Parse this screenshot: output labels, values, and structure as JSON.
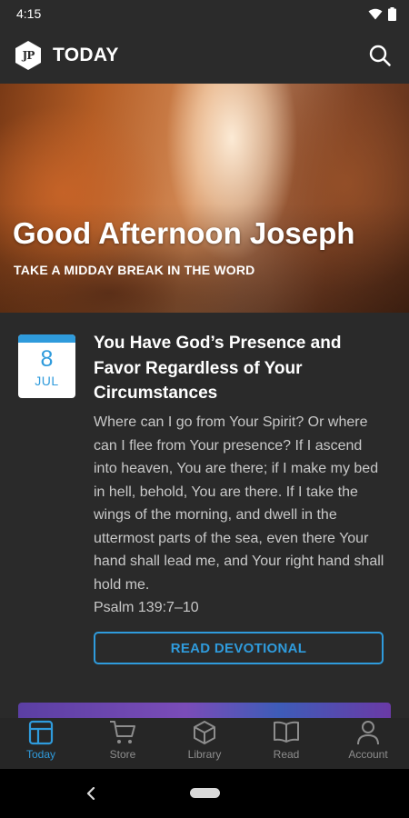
{
  "status_bar": {
    "time": "4:15"
  },
  "app_bar": {
    "logo_text": "JP",
    "title": "TODAY"
  },
  "hero": {
    "greeting": "Good Afternoon Joseph",
    "subtitle": "TAKE A MIDDAY BREAK IN THE WORD"
  },
  "devotional": {
    "date_day": "8",
    "date_month": "JUL",
    "title": "You Have God’s Presence and Favor Regardless of Your Circumstances",
    "body": "Where can I go from Your Spirit? Or where can I flee from Your presence? If I ascend into heaven, You are there; if I make my bed in hell, behold, You are there. If I take the wings of the morning, and dwell in the uttermost parts of the sea, even there Your hand shall lead me, and Your right hand shall hold me.",
    "reference": "Psalm 139:7–10",
    "button_label": "READ DEVOTIONAL"
  },
  "bottom_nav": {
    "items": [
      {
        "label": "Today",
        "icon": "today-icon",
        "active": true
      },
      {
        "label": "Store",
        "icon": "cart-icon",
        "active": false
      },
      {
        "label": "Library",
        "icon": "cube-icon",
        "active": false
      },
      {
        "label": "Read",
        "icon": "book-icon",
        "active": false
      },
      {
        "label": "Account",
        "icon": "person-icon",
        "active": false
      }
    ]
  },
  "colors": {
    "accent": "#2f9bdc",
    "background": "#2a2a2a",
    "inactive_nav": "#8d8d8d"
  }
}
